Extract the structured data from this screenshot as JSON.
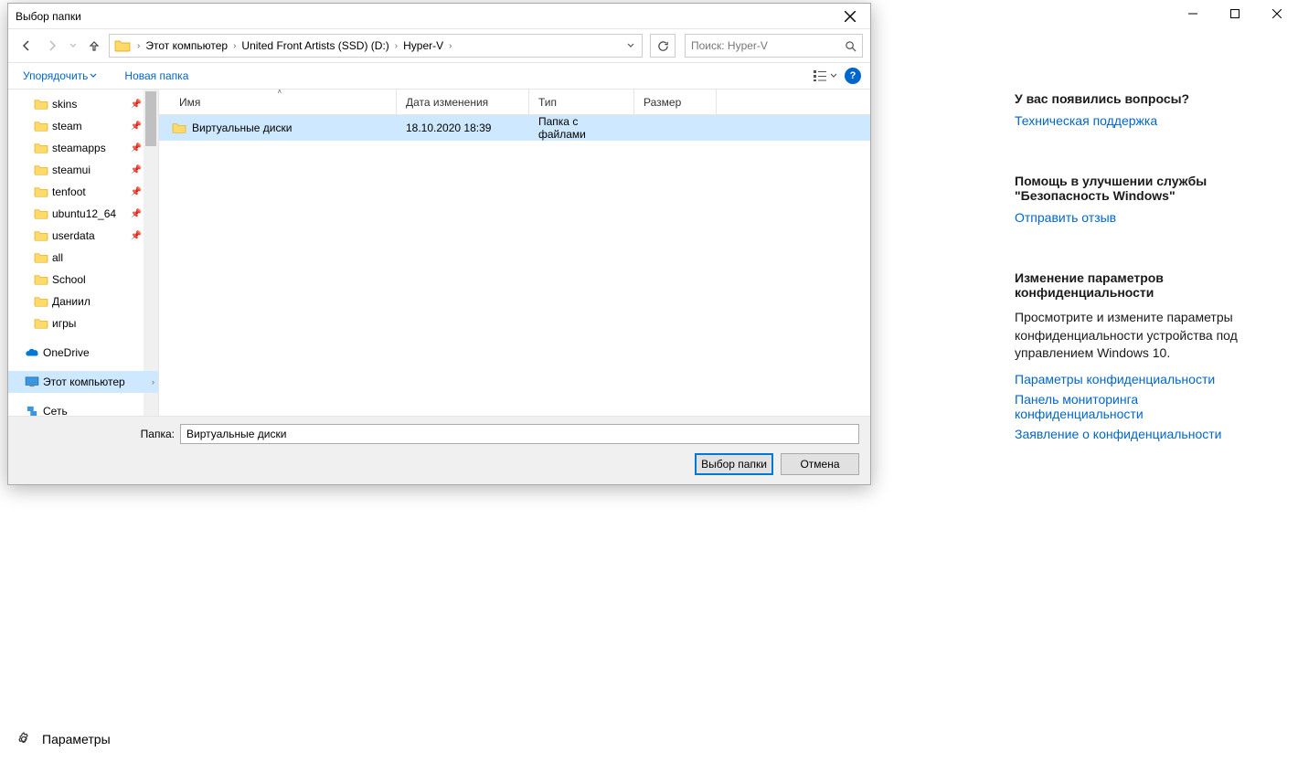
{
  "app": {
    "footer_label": "Параметры"
  },
  "right_panel": {
    "q_heading": "У вас появились вопросы?",
    "q_link": "Техническая поддержка",
    "help_heading": "Помощь в улучшении службы \"Безопасность Windows\"",
    "help_link": "Отправить отзыв",
    "priv_heading": "Изменение параметров конфиденциальности",
    "priv_text": "Просмотрите и измените параметры конфиденциальности устройства под управлением Windows 10.",
    "priv_link1": "Параметры конфиденциальности",
    "priv_link2": "Панель мониторинга конфиденциальности",
    "priv_link3": "Заявление о конфиденциальности"
  },
  "dialog": {
    "title": "Выбор папки",
    "breadcrumb": {
      "seg1": "Этот компьютер",
      "seg2": "United Front Artists (SSD) (D:)",
      "seg3": "Hyper-V"
    },
    "search_placeholder": "Поиск: Hyper-V",
    "toolbar": {
      "organize": "Упорядочить",
      "new_folder": "Новая папка"
    },
    "columns": {
      "name": "Имя",
      "date": "Дата изменения",
      "type": "Тип",
      "size": "Размер"
    },
    "tree": [
      {
        "label": "skins",
        "pin": true
      },
      {
        "label": "steam",
        "pin": true
      },
      {
        "label": "steamapps",
        "pin": true
      },
      {
        "label": "steamui",
        "pin": true
      },
      {
        "label": "tenfoot",
        "pin": true
      },
      {
        "label": "ubuntu12_64",
        "pin": true
      },
      {
        "label": "userdata",
        "pin": true
      },
      {
        "label": "all"
      },
      {
        "label": "School"
      },
      {
        "label": "Даниил"
      },
      {
        "label": "игры"
      }
    ],
    "onedrive": "OneDrive",
    "this_pc": "Этот компьютер",
    "network": "Сеть",
    "files": [
      {
        "name": "Виртуальные диски",
        "date": "18.10.2020 18:39",
        "type": "Папка с файлами",
        "size": ""
      }
    ],
    "footer_label": "Папка:",
    "footer_value": "Виртуальные диски",
    "btn_select": "Выбор папки",
    "btn_cancel": "Отмена"
  }
}
